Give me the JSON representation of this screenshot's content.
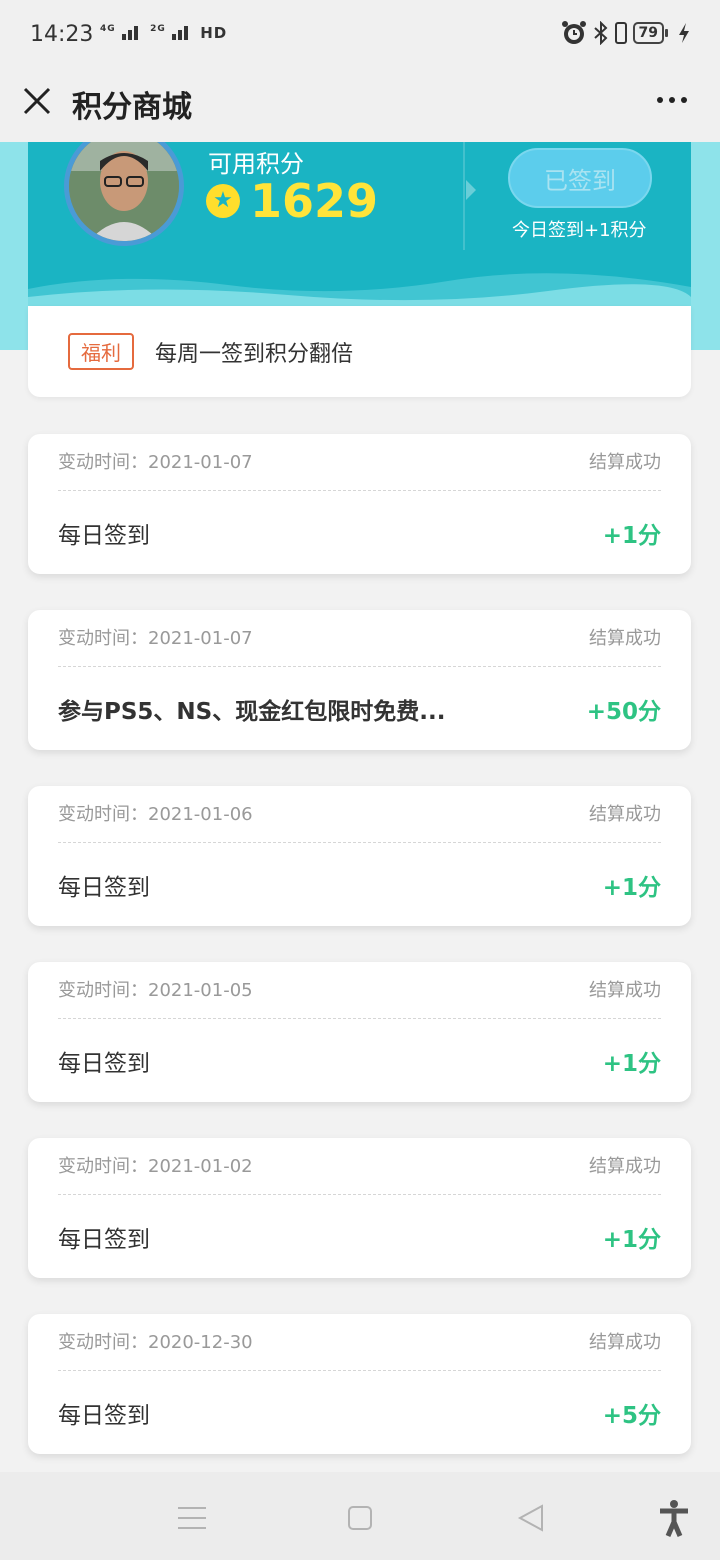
{
  "status_bar": {
    "time": "14:23",
    "network_1": "4G",
    "network_2": "2G",
    "network_hd": "HD",
    "battery": "79",
    "icons": [
      "alarm-icon",
      "bluetooth-icon",
      "vibrate-icon",
      "charging-icon"
    ]
  },
  "title_bar": {
    "title": "积分商城",
    "close_icon": "close-icon",
    "more_icon": "more-icon"
  },
  "points_card": {
    "avatar_icon": "avatar",
    "available_label": "可用积分",
    "points": "1629",
    "signed_button": "已签到",
    "sign_hint": "今日签到+1积分"
  },
  "welfare": {
    "tag": "福利",
    "text": "每周一签到积分翻倍"
  },
  "records": [
    {
      "time": "变动时间：2021-01-07",
      "status": "结算成功",
      "title": "每日签到",
      "points": "+1分"
    },
    {
      "time": "变动时间：2021-01-07",
      "status": "结算成功",
      "title": "参与PS5、NS、现金红包限时免费...",
      "points": "+50分"
    },
    {
      "time": "变动时间：2021-01-06",
      "status": "结算成功",
      "title": "每日签到",
      "points": "+1分"
    },
    {
      "time": "变动时间：2021-01-05",
      "status": "结算成功",
      "title": "每日签到",
      "points": "+1分"
    },
    {
      "time": "变动时间：2021-01-02",
      "status": "结算成功",
      "title": "每日签到",
      "points": "+1分"
    },
    {
      "time": "变动时间：2020-12-30",
      "status": "结算成功",
      "title": "每日签到",
      "points": "+5分"
    }
  ],
  "nav_bar": {
    "icons": [
      "menu-icon",
      "home-icon",
      "back-icon",
      "accessibility-icon"
    ]
  },
  "colors": {
    "hero": "#1ab4c3",
    "points_value": "#ffe43a",
    "record_points": "#2ec383",
    "welfare_tag": "#e56a3e"
  }
}
